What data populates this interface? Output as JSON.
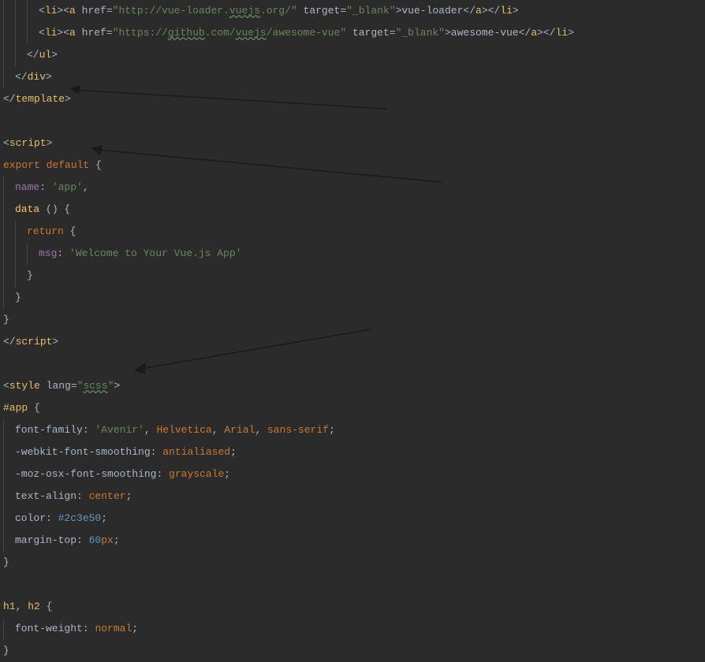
{
  "lines": {
    "l1_li": "li",
    "l1_a": "a",
    "l1_href": " href=",
    "l1_url": "\"http://vue-loader.",
    "l1_vuejs": "vuejs",
    "l1_urlend": ".org/\"",
    "l1_target": " target=",
    "l1_blank": "\"_blank\"",
    "l1_text": "vue-loader",
    "l1_ca": "a",
    "l1_cli": "li",
    "l2_li": "li",
    "l2_a": "a",
    "l2_href": " href=",
    "l2_q1": "\"https://",
    "l2_github": "github",
    "l2_dotcom": ".com/",
    "l2_vuejs": "vuejs",
    "l2_awesome": "/awesome-vue\"",
    "l2_target": " target=",
    "l2_blank": "\"_blank\"",
    "l2_text": "awesome-vue",
    "l2_ca": "a",
    "l2_cli": "li",
    "l3_ul": "ul",
    "l4_div": "div",
    "l5_template": "template",
    "l6_script": "script",
    "l7_export": "export default ",
    "l7_brace": "{",
    "l8_name": "name",
    "l8_colon": ": ",
    "l8_val": "'app'",
    "l8_comma": ",",
    "l9_data": "data ",
    "l9_paren": "()",
    "l9_brace": " {",
    "l10_return": "return ",
    "l10_brace": "{",
    "l11_msg": "msg",
    "l11_colon": ": ",
    "l11_val": "'Welcome to Your Vue.js App'",
    "l12_brace": "}",
    "l13_brace": "}",
    "l14_brace": "}",
    "l15_script": "script",
    "l16_style": "style",
    "l16_lang": " lang=",
    "l16_q": "\"",
    "l16_scss": "scss",
    "l16_q2": "\"",
    "l17_sel": "#app",
    "l17_brace": " {",
    "l18_prop": "font-family",
    "l18_c": ": ",
    "l18_v1": "'Avenir'",
    "l18_c1": ", ",
    "l18_v2": "Helvetica",
    "l18_c2": ", ",
    "l18_v3": "Arial",
    "l18_c3": ", ",
    "l18_v4": "sans-serif",
    "l18_sc": ";",
    "l19_prop": "-webkit-font-smoothing",
    "l19_c": ": ",
    "l19_v": "antialiased",
    "l19_sc": ";",
    "l20_prop": "-moz-osx-font-smoothing",
    "l20_c": ": ",
    "l20_v": "grayscale",
    "l20_sc": ";",
    "l21_prop": "text-align",
    "l21_c": ": ",
    "l21_v": "center",
    "l21_sc": ";",
    "l22_prop": "color",
    "l22_c": ": ",
    "l22_v": "#2c3e50",
    "l22_sc": ";",
    "l23_prop": "margin-top",
    "l23_c": ": ",
    "l23_v": "60",
    "l23_px": "px",
    "l23_sc": ";",
    "l24_brace": "}",
    "l25_h1": "h1",
    "l25_comma": ", ",
    "l25_h2": "h2",
    "l25_brace": " {",
    "l26_prop": "font-weight",
    "l26_c": ": ",
    "l26_v": "normal",
    "l26_sc": ";",
    "l27_brace": "}"
  }
}
